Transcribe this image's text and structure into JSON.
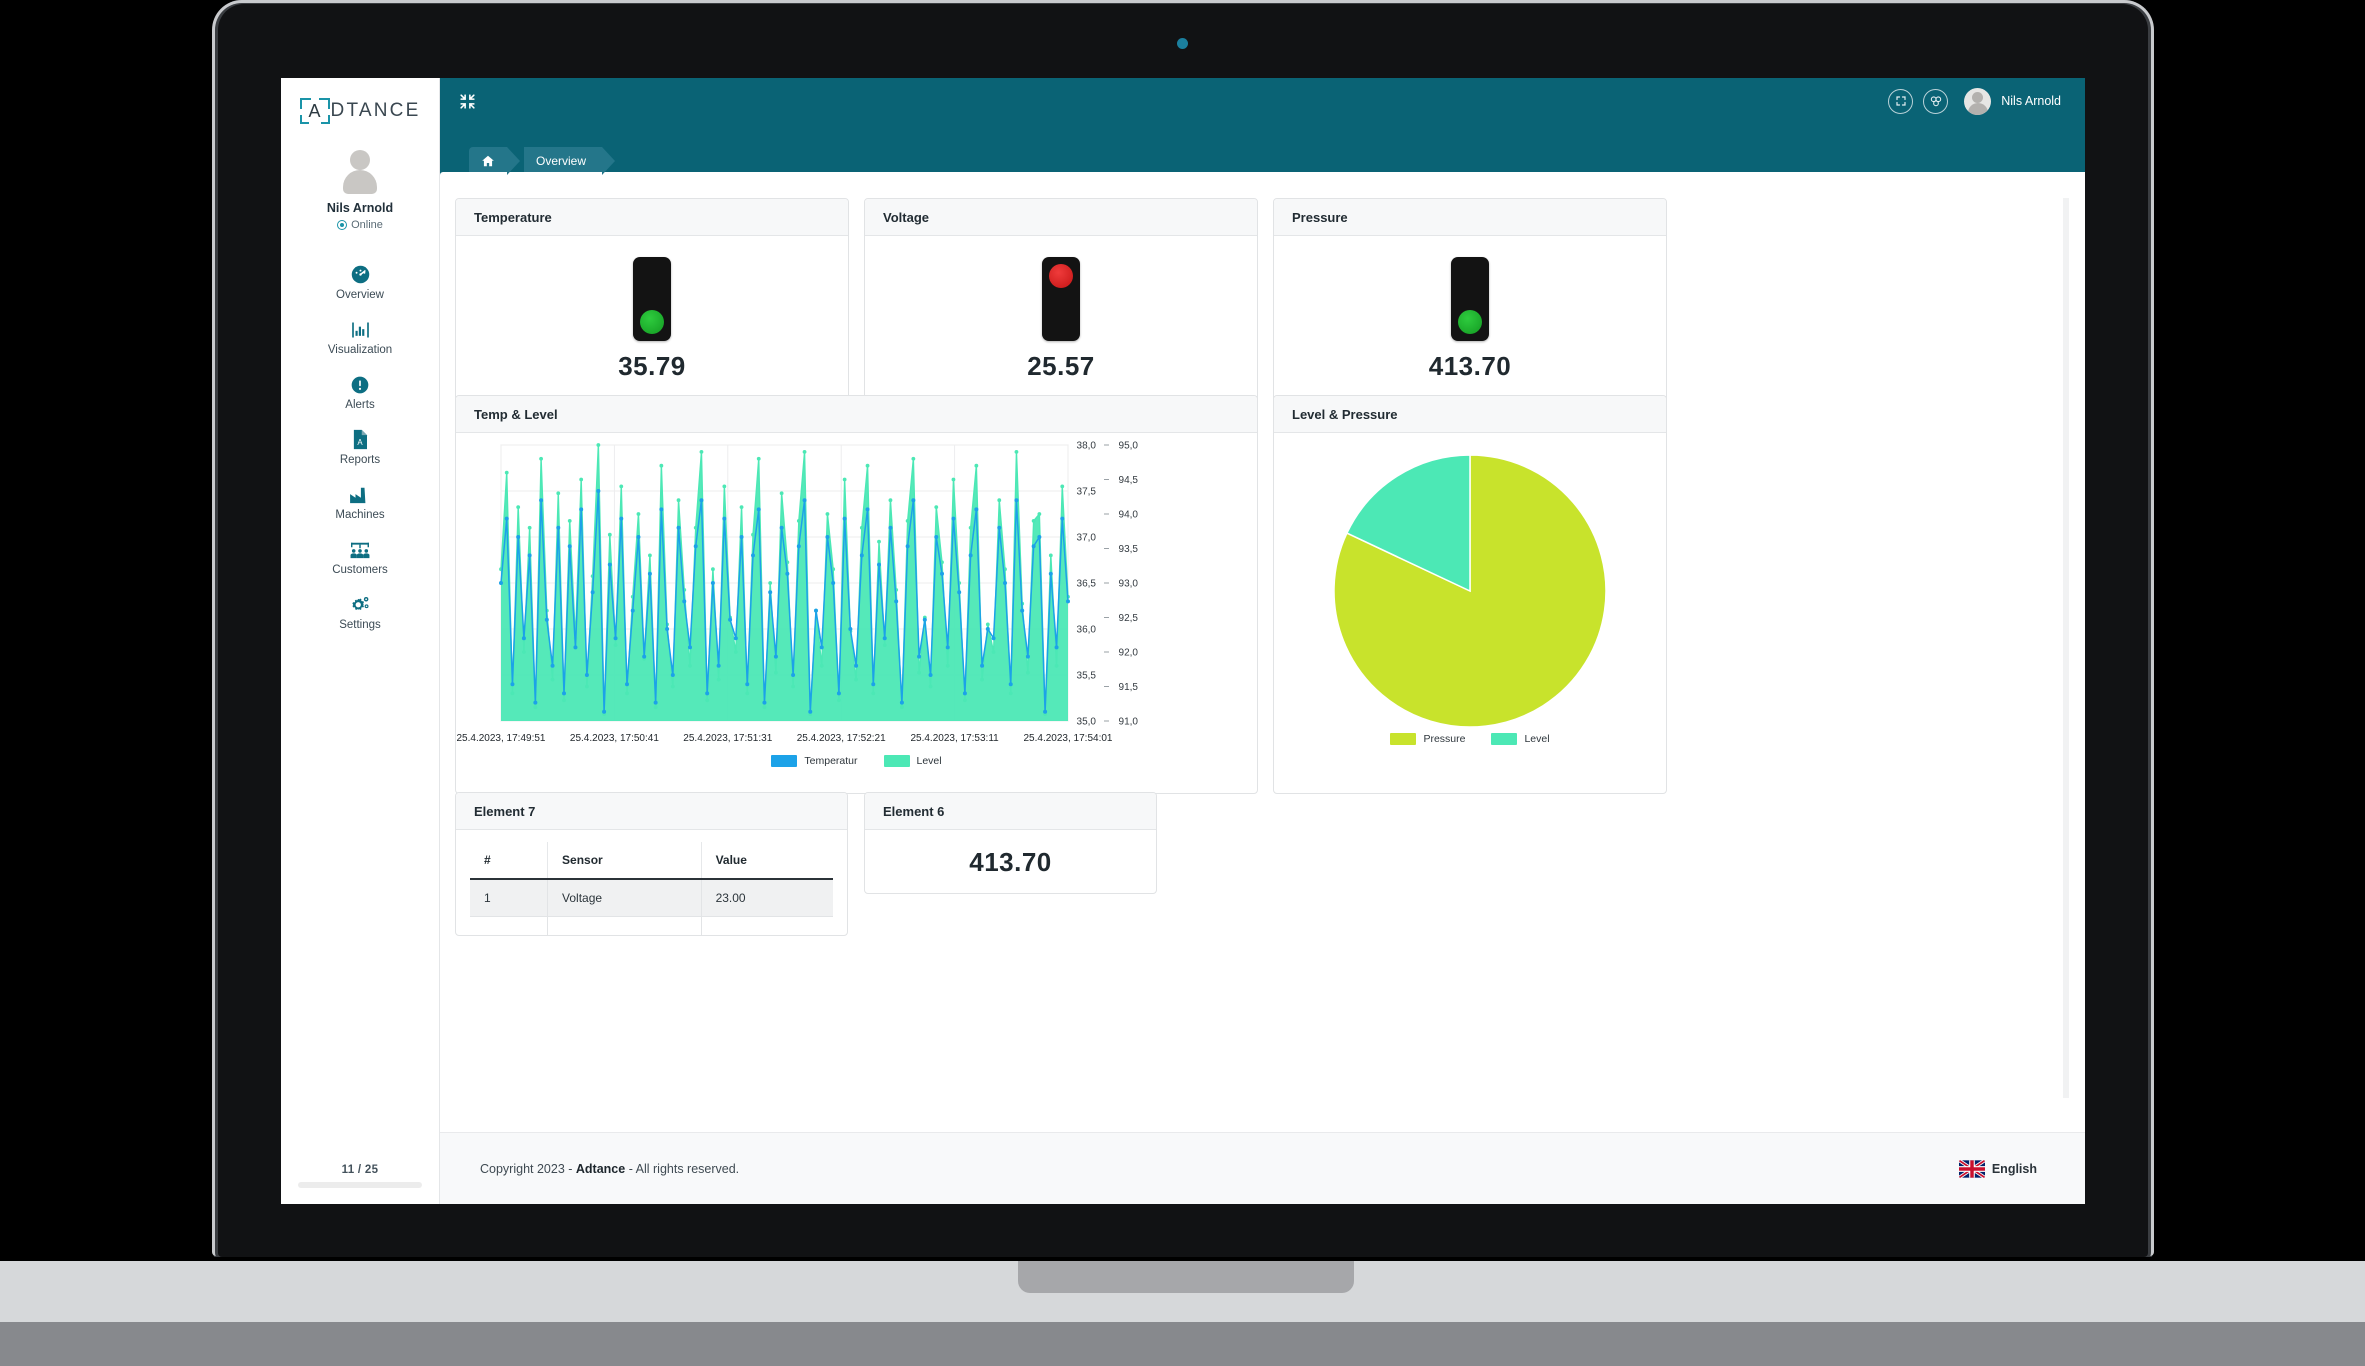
{
  "brand": {
    "logo_letter": "A",
    "logo_text": "DTANCE"
  },
  "sidebar": {
    "username": "Nils Arnold",
    "status": "Online",
    "items": [
      {
        "label": "Overview",
        "icon": "gauge-icon"
      },
      {
        "label": "Visualization",
        "icon": "bar-chart-icon"
      },
      {
        "label": "Alerts",
        "icon": "exclamation-circle-icon"
      },
      {
        "label": "Reports",
        "icon": "pdf-file-icon"
      },
      {
        "label": "Machines",
        "icon": "factory-icon"
      },
      {
        "label": "Customers",
        "icon": "people-group-icon"
      },
      {
        "label": "Settings",
        "icon": "gears-icon"
      }
    ],
    "page_counter": "11 / 25"
  },
  "topbar": {
    "collapse_icon": "collapse-arrows-icon",
    "fullscreen_icon": "fullscreen-icon",
    "modules_icon": "modules-icon",
    "username": "Nils Arnold"
  },
  "breadcrumb": {
    "home_icon": "home-icon",
    "current": "Overview"
  },
  "gauges": [
    {
      "title": "Temperature",
      "value": "35.79",
      "lamp": "green",
      "lamp_position": "bottom"
    },
    {
      "title": "Voltage",
      "value": "25.57",
      "lamp": "red",
      "lamp_position": "top"
    },
    {
      "title": "Pressure",
      "value": "413.70",
      "lamp": "green",
      "lamp_position": "bottom"
    }
  ],
  "cards": {
    "line_chart_title": "Temp & Level",
    "pie_chart_title": "Level & Pressure",
    "table_card_title": "Element 7",
    "value_card_title": "Element 6",
    "value_card_value": "413.70"
  },
  "table": {
    "columns": [
      "#",
      "Sensor",
      "Value"
    ],
    "rows": [
      [
        "1",
        "Voltage",
        "23.00"
      ]
    ]
  },
  "footer": {
    "copyright_prefix": "Copyright 2023 - ",
    "copyright_brand": "Adtance",
    "copyright_suffix": " - All rights reserved.",
    "language": "English",
    "flag_icon": "uk-flag-icon"
  },
  "colors": {
    "teal_header": "#0a6375",
    "breadcrumb": "#24768a",
    "temperature_series": "#1CA2E8",
    "level_series": "#4CE8B5",
    "pressure_slice": "#C8E32C",
    "lamp_green": "#20b02e",
    "lamp_red": "#e02525"
  },
  "chart_data": [
    {
      "type": "line",
      "title": "Temp & Level",
      "xlabel": "",
      "ylabel": "",
      "grid": true,
      "legend_position": "bottom",
      "x_tick_labels": [
        "25.4.2023, 17:49:51",
        "25.4.2023, 17:50:41",
        "25.4.2023, 17:51:31",
        "25.4.2023, 17:52:21",
        "25.4.2023, 17:53:11",
        "25.4.2023, 17:54:01"
      ],
      "y_left_ticks": [
        "38,0",
        "37,5",
        "37,0",
        "36,5",
        "36,0",
        "35,5",
        "35,0"
      ],
      "y_left_lim": [
        35.0,
        38.0
      ],
      "y_right_ticks": [
        "95,0",
        "94,5",
        "94,0",
        "93,5",
        "93,0",
        "92,5",
        "92,0",
        "91,5",
        "91,0"
      ],
      "y_right_lim": [
        91.0,
        95.0
      ],
      "series": [
        {
          "name": "Temperatur",
          "axis": "left",
          "color": "#1CA2E8",
          "values": [
            36.5,
            37.2,
            35.4,
            37.0,
            35.9,
            36.8,
            35.2,
            37.4,
            36.1,
            35.6,
            37.1,
            35.3,
            36.9,
            35.8,
            37.3,
            35.5,
            36.4,
            37.5,
            35.1,
            36.7,
            35.9,
            37.2,
            35.4,
            36.2,
            37.0,
            35.7,
            36.6,
            35.2,
            37.3,
            36.0,
            35.5,
            37.1,
            36.3,
            35.8,
            36.9,
            37.4,
            35.3,
            36.5,
            35.6,
            37.2,
            36.1,
            35.9,
            37.0,
            35.4,
            36.8,
            37.3,
            35.2,
            36.4,
            35.7,
            37.1,
            36.6,
            35.5,
            36.9,
            37.4,
            35.1,
            36.2,
            35.8,
            37.0,
            36.5,
            35.3,
            37.2,
            36.0,
            35.6,
            36.8,
            37.3,
            35.4,
            36.7,
            35.9,
            37.1,
            36.3,
            35.2,
            36.9,
            37.4,
            35.7,
            36.1,
            35.5,
            37.0,
            36.6,
            35.8,
            37.2,
            36.4,
            35.3,
            36.8,
            37.3,
            35.6,
            36.0,
            35.9,
            37.1,
            36.5,
            35.4,
            37.4,
            36.2,
            35.7,
            36.9,
            37.0,
            35.1,
            36.6,
            35.8,
            37.2,
            36.3
          ]
        },
        {
          "name": "Level",
          "axis": "right",
          "color": "#4CE8B5",
          "fill": true,
          "values": [
            93.2,
            94.6,
            91.4,
            94.1,
            92.0,
            93.8,
            91.2,
            94.8,
            92.6,
            91.6,
            94.3,
            91.3,
            93.9,
            92.2,
            94.5,
            91.5,
            93.1,
            95.0,
            91.1,
            93.7,
            92.1,
            94.4,
            91.4,
            92.8,
            94.0,
            91.9,
            93.4,
            91.2,
            94.7,
            92.4,
            91.5,
            94.2,
            92.9,
            91.8,
            93.8,
            94.9,
            91.3,
            93.2,
            91.6,
            94.4,
            92.5,
            92.0,
            94.1,
            91.4,
            93.7,
            94.8,
            91.2,
            93.0,
            91.7,
            94.3,
            93.3,
            91.5,
            93.9,
            94.9,
            91.1,
            92.6,
            91.8,
            94.0,
            93.2,
            91.3,
            94.5,
            92.3,
            91.6,
            93.8,
            94.7,
            91.4,
            93.6,
            92.1,
            94.2,
            92.9,
            91.2,
            93.9,
            94.8,
            91.7,
            92.5,
            91.5,
            94.1,
            93.3,
            91.8,
            94.5,
            93.0,
            91.3,
            93.8,
            94.7,
            91.6,
            92.4,
            92.0,
            94.2,
            93.2,
            91.4,
            94.9,
            92.7,
            91.7,
            93.9,
            94.0,
            91.1,
            93.4,
            91.8,
            94.4,
            92.8
          ]
        }
      ]
    },
    {
      "type": "pie",
      "title": "Level & Pressure",
      "legend_position": "bottom",
      "labels": [
        "Pressure",
        "Level"
      ],
      "values": [
        82,
        18
      ],
      "colors": [
        "#C8E32C",
        "#4CE8B5"
      ]
    }
  ]
}
